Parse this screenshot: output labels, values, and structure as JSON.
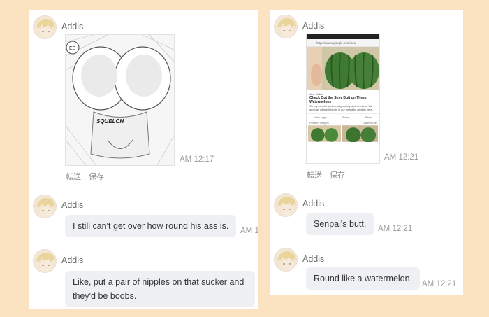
{
  "left_panel": {
    "messages": [
      {
        "sender": "Addis",
        "kind": "image",
        "image_caption": "SQUELCH",
        "image_mark": "EE",
        "time": "AM 12:17",
        "actions": [
          "転送",
          "保存"
        ]
      },
      {
        "sender": "Addis",
        "kind": "text",
        "text": "I still can't get over how round his ass is.",
        "time": "AM 1"
      },
      {
        "sender": "Addis",
        "kind": "text",
        "text_line1": "Like, put a pair of nipples on that sucker and",
        "text_line2": "they'd be boobs."
      }
    ]
  },
  "right_panel": {
    "messages": [
      {
        "sender": "Addis",
        "kind": "image",
        "time": "AM 12:21",
        "actions": [
          "転送",
          "保存"
        ],
        "screenshot": {
          "url": "https://www.google.com/sea",
          "source": "Abc · Addis",
          "title_line1": "Check Out the Sexy Butt on These",
          "title_line2": "Watermelons",
          "snippet": "So my favorite picture of growing watermelons. We grow all different kinds in our beautiful garden here.",
          "actions": [
            "Visit page",
            "Share",
            "Save"
          ],
          "related": "Related images",
          "more": "View more"
        }
      },
      {
        "sender": "Addis",
        "kind": "text",
        "text": "Senpai's butt.",
        "time": "AM 12:21"
      },
      {
        "sender": "Addis",
        "kind": "text",
        "text": "Round like a watermelon.",
        "time": "AM 12:21"
      }
    ]
  },
  "colors": {
    "background": "#fbe3c2",
    "panel": "#ffffff",
    "bubble": "#eef0f3",
    "name_text": "#6a6a6a",
    "time_text": "#9a9a9a"
  },
  "icons": [
    "avatar",
    "manga-image",
    "phone-screenshot-image",
    "share-icon",
    "star-icon"
  ]
}
